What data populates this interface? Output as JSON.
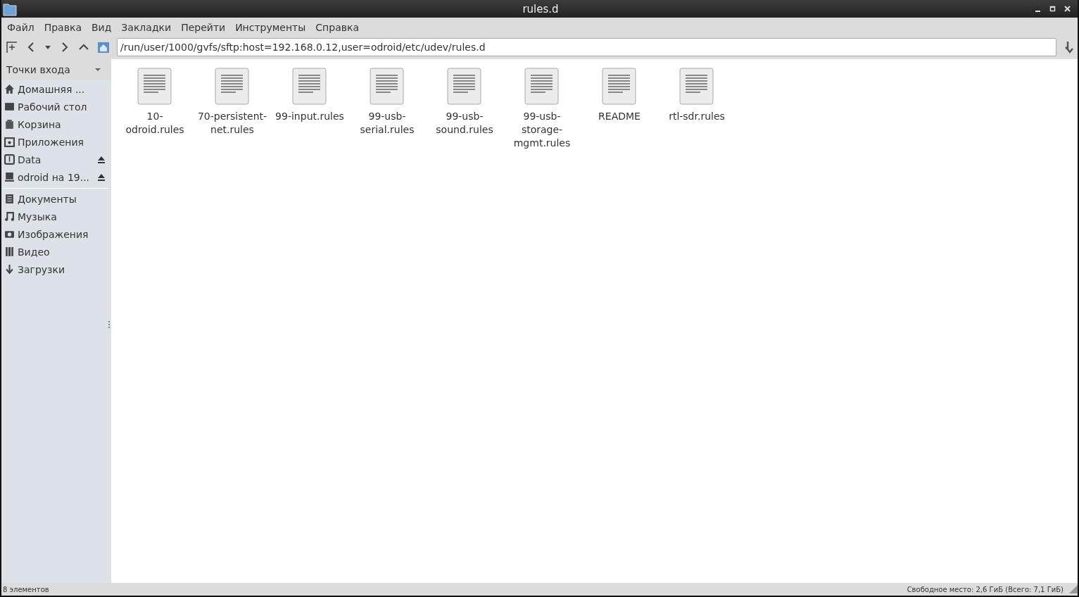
{
  "window": {
    "title": "rules.d"
  },
  "menu": [
    "Файл",
    "Правка",
    "Вид",
    "Закладки",
    "Перейти",
    "Инструменты",
    "Справка"
  ],
  "location": {
    "value": "/run/user/1000/gvfs/sftp:host=192.168.0.12,user=odroid/etc/udev/rules.d"
  },
  "sidebar": {
    "header": "Точки входа",
    "groups": [
      [
        {
          "label": "Домашняя ...",
          "kind": "home",
          "ejectable": false
        },
        {
          "label": "Рабочий стол",
          "kind": "desktop",
          "ejectable": false
        },
        {
          "label": "Корзина",
          "kind": "trash",
          "ejectable": false
        },
        {
          "label": "Приложения",
          "kind": "apps",
          "ejectable": false
        },
        {
          "label": "Data",
          "kind": "drive",
          "ejectable": true
        },
        {
          "label": "odroid на 19...",
          "kind": "network",
          "ejectable": true
        }
      ],
      [
        {
          "label": "Документы",
          "kind": "documents",
          "ejectable": false
        },
        {
          "label": "Музыка",
          "kind": "music",
          "ejectable": false
        },
        {
          "label": "Изображения",
          "kind": "pictures",
          "ejectable": false
        },
        {
          "label": "Видео",
          "kind": "video",
          "ejectable": false
        },
        {
          "label": "Загрузки",
          "kind": "downloads",
          "ejectable": false
        }
      ]
    ]
  },
  "files": [
    {
      "name_lines": [
        "10-",
        "odroid.rules"
      ]
    },
    {
      "name_lines": [
        "70-persistent-",
        "net.rules"
      ]
    },
    {
      "name_lines": [
        "99-input.rules"
      ]
    },
    {
      "name_lines": [
        "99-usb-",
        "serial.rules"
      ]
    },
    {
      "name_lines": [
        "99-usb-",
        "sound.rules"
      ]
    },
    {
      "name_lines": [
        "99-usb-",
        "storage-",
        "mgmt.rules"
      ]
    },
    {
      "name_lines": [
        "README"
      ]
    },
    {
      "name_lines": [
        "rtl-sdr.rules"
      ]
    }
  ],
  "status_bar": {
    "left": "8 элементов",
    "right": "Свободное место: 2,6 ГиБ (Всего: 7,1 ГиБ)"
  }
}
